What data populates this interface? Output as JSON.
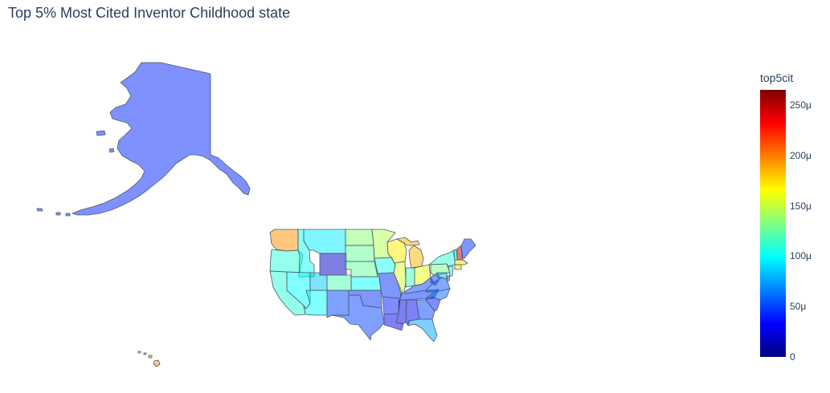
{
  "title": "Top 5% Most Cited Inventor Childhood state",
  "colorbar": {
    "title": "top5cit",
    "min": 0,
    "max": 0.000265,
    "ticks": [
      {
        "value": 0,
        "label": "0"
      },
      {
        "value": 5e-05,
        "label": "50μ"
      },
      {
        "value": 0.0001,
        "label": "100μ"
      },
      {
        "value": 0.00015,
        "label": "150μ"
      },
      {
        "value": 0.0002,
        "label": "200μ"
      },
      {
        "value": 0.00025,
        "label": "250μ"
      }
    ],
    "colorscale": [
      "#00007f",
      "#0000ff",
      "#007fff",
      "#00ffff",
      "#7fff7f",
      "#ffff00",
      "#ff7f00",
      "#ff0000",
      "#7f0000"
    ]
  },
  "chart_data": {
    "type": "choropleth",
    "scope": "usa",
    "variable": "top5cit",
    "states": [
      {
        "name": "AK",
        "value": 4.2e-05
      },
      {
        "name": "HI",
        "value": 0.000195
      },
      {
        "name": "WA",
        "value": 0.000195
      },
      {
        "name": "OR",
        "value": 0.00011
      },
      {
        "name": "CA",
        "value": 0.00011
      },
      {
        "name": "ID",
        "value": 0.000105
      },
      {
        "name": "NV",
        "value": 0.0001
      },
      {
        "name": "MT",
        "value": 9.5e-05
      },
      {
        "name": "WY",
        "value": 1.8e-05
      },
      {
        "name": "UT",
        "value": 8.5e-05
      },
      {
        "name": "AZ",
        "value": 0.0001
      },
      {
        "name": "CO",
        "value": 0.00012
      },
      {
        "name": "NM",
        "value": 5e-05
      },
      {
        "name": "ND",
        "value": 0.000135
      },
      {
        "name": "SD",
        "value": 0.000125
      },
      {
        "name": "NE",
        "value": 0.000125
      },
      {
        "name": "KS",
        "value": 0.0001
      },
      {
        "name": "OK",
        "value": 4.5e-05
      },
      {
        "name": "TX",
        "value": 5e-05
      },
      {
        "name": "MN",
        "value": 0.000145
      },
      {
        "name": "IA",
        "value": 0.000105
      },
      {
        "name": "MO",
        "value": 4.5e-05
      },
      {
        "name": "AR",
        "value": 4e-05
      },
      {
        "name": "LA",
        "value": 3e-05
      },
      {
        "name": "WI",
        "value": 0.00017
      },
      {
        "name": "IL",
        "value": 0.000155
      },
      {
        "name": "MI",
        "value": 0.000185
      },
      {
        "name": "IN",
        "value": 0.000115
      },
      {
        "name": "OH",
        "value": 0.00016
      },
      {
        "name": "KY",
        "value": 5e-05
      },
      {
        "name": "TN",
        "value": 4.5e-05
      },
      {
        "name": "MS",
        "value": 2.5e-05
      },
      {
        "name": "AL",
        "value": 3e-05
      },
      {
        "name": "GA",
        "value": 5e-05
      },
      {
        "name": "FL",
        "value": 7.5e-05
      },
      {
        "name": "SC",
        "value": 4e-05
      },
      {
        "name": "NC",
        "value": 6e-05
      },
      {
        "name": "VA",
        "value": 5.5e-05
      },
      {
        "name": "WV",
        "value": 5e-05
      },
      {
        "name": "PA",
        "value": 0.00013
      },
      {
        "name": "NY",
        "value": 0.00011
      },
      {
        "name": "VT",
        "value": 0.00011
      },
      {
        "name": "NH",
        "value": 0.00025
      },
      {
        "name": "ME",
        "value": 4.5e-05
      },
      {
        "name": "MA",
        "value": 0.000175
      },
      {
        "name": "CT",
        "value": 0.000175
      },
      {
        "name": "NJ",
        "value": 0.00011
      },
      {
        "name": "DE",
        "value": 6e-05
      },
      {
        "name": "MD",
        "value": 8e-05
      }
    ]
  }
}
